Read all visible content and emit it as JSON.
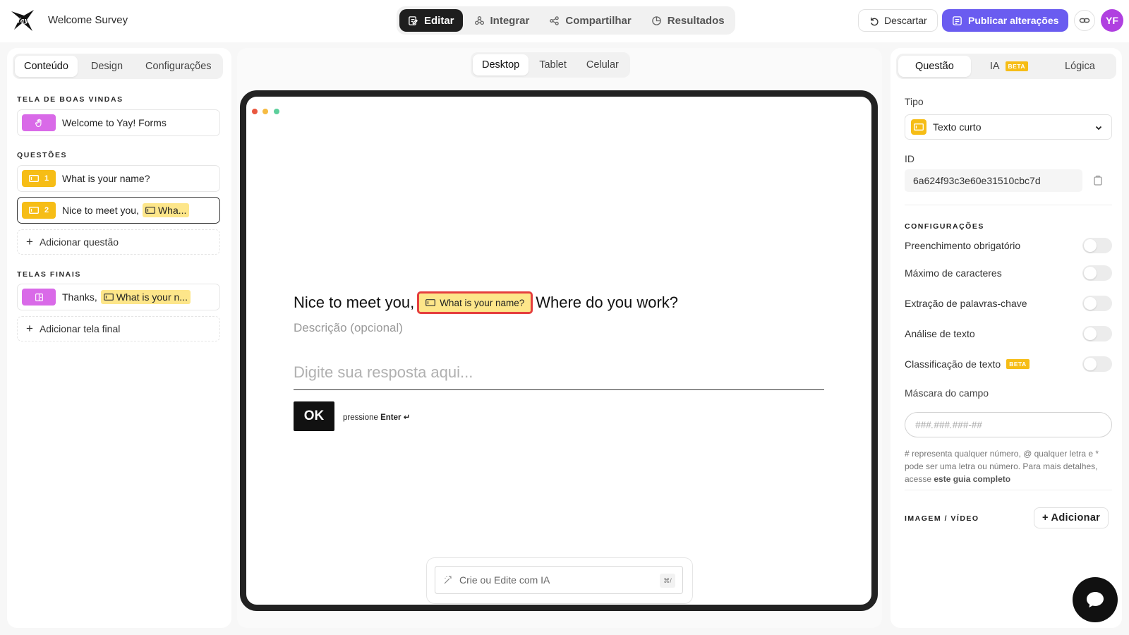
{
  "header": {
    "title": "Welcome Survey",
    "tabs": [
      {
        "label": "Editar",
        "icon": "edit-icon"
      },
      {
        "label": "Integrar",
        "icon": "integrate-icon"
      },
      {
        "label": "Compartilhar",
        "icon": "share-icon"
      },
      {
        "label": "Resultados",
        "icon": "results-icon"
      }
    ],
    "discard_label": "Descartar",
    "publish_label": "Publicar alterações",
    "avatar_initials": "YF"
  },
  "left": {
    "tabs": [
      "Conteúdo",
      "Design",
      "Configurações"
    ],
    "welcome_section": "TELA DE BOAS VINDAS",
    "welcome_item": "Welcome to Yay! Forms",
    "questions_section": "QUESTÕES",
    "questions": [
      {
        "number": "1",
        "text": "What is your name?",
        "chip": ""
      },
      {
        "number": "2",
        "text": "Nice to meet you,",
        "chip": "Wha..."
      }
    ],
    "add_question": "Adicionar questão",
    "end_section": "TELAS FINAIS",
    "end_item": {
      "text": "Thanks,",
      "chip": "What is your n..."
    },
    "add_end": "Adicionar tela final"
  },
  "center": {
    "device_tabs": [
      "Desktop",
      "Tablet",
      "Celular"
    ],
    "question_prefix": "Nice to meet you,",
    "question_chip": "What is your name?",
    "question_suffix": "Where do you work?",
    "description": "Descrição (opcional)",
    "answer_placeholder": "Digite sua resposta aqui...",
    "ok_label": "OK",
    "hint_prefix": "pressione",
    "hint_key": "Enter ↵",
    "ai_placeholder": "Crie ou Edite com IA",
    "ai_shortcut": "⌘/"
  },
  "right": {
    "tabs": [
      "Questão",
      "IA",
      "Lógica"
    ],
    "beta_label": "BETA",
    "type_label": "Tipo",
    "type_value": "Texto curto",
    "id_label": "ID",
    "id_value": "6a624f93c3e60e31510cbc7d",
    "settings_section": "CONFIGURAÇÕES",
    "toggles": [
      "Preenchimento obrigatório",
      "Máximo de caracteres",
      "Extração de palavras-chave",
      "Análise de texto",
      "Classificação de texto"
    ],
    "mask_label": "Máscara do campo",
    "mask_placeholder": "###.###.###-##",
    "help_text": "# representa qualquer número, @ qualquer letra e * pode ser uma letra ou número. Para mais detalhes, acesse",
    "help_link": "este guia completo",
    "media_section": "IMAGEM / VÍDEO",
    "media_add": "+ Adicionar"
  },
  "colors": {
    "accent": "#6a5cf0",
    "yellow": "#f6bd16",
    "purple": "#d96ae8",
    "highlight_border": "#e53e3e"
  }
}
